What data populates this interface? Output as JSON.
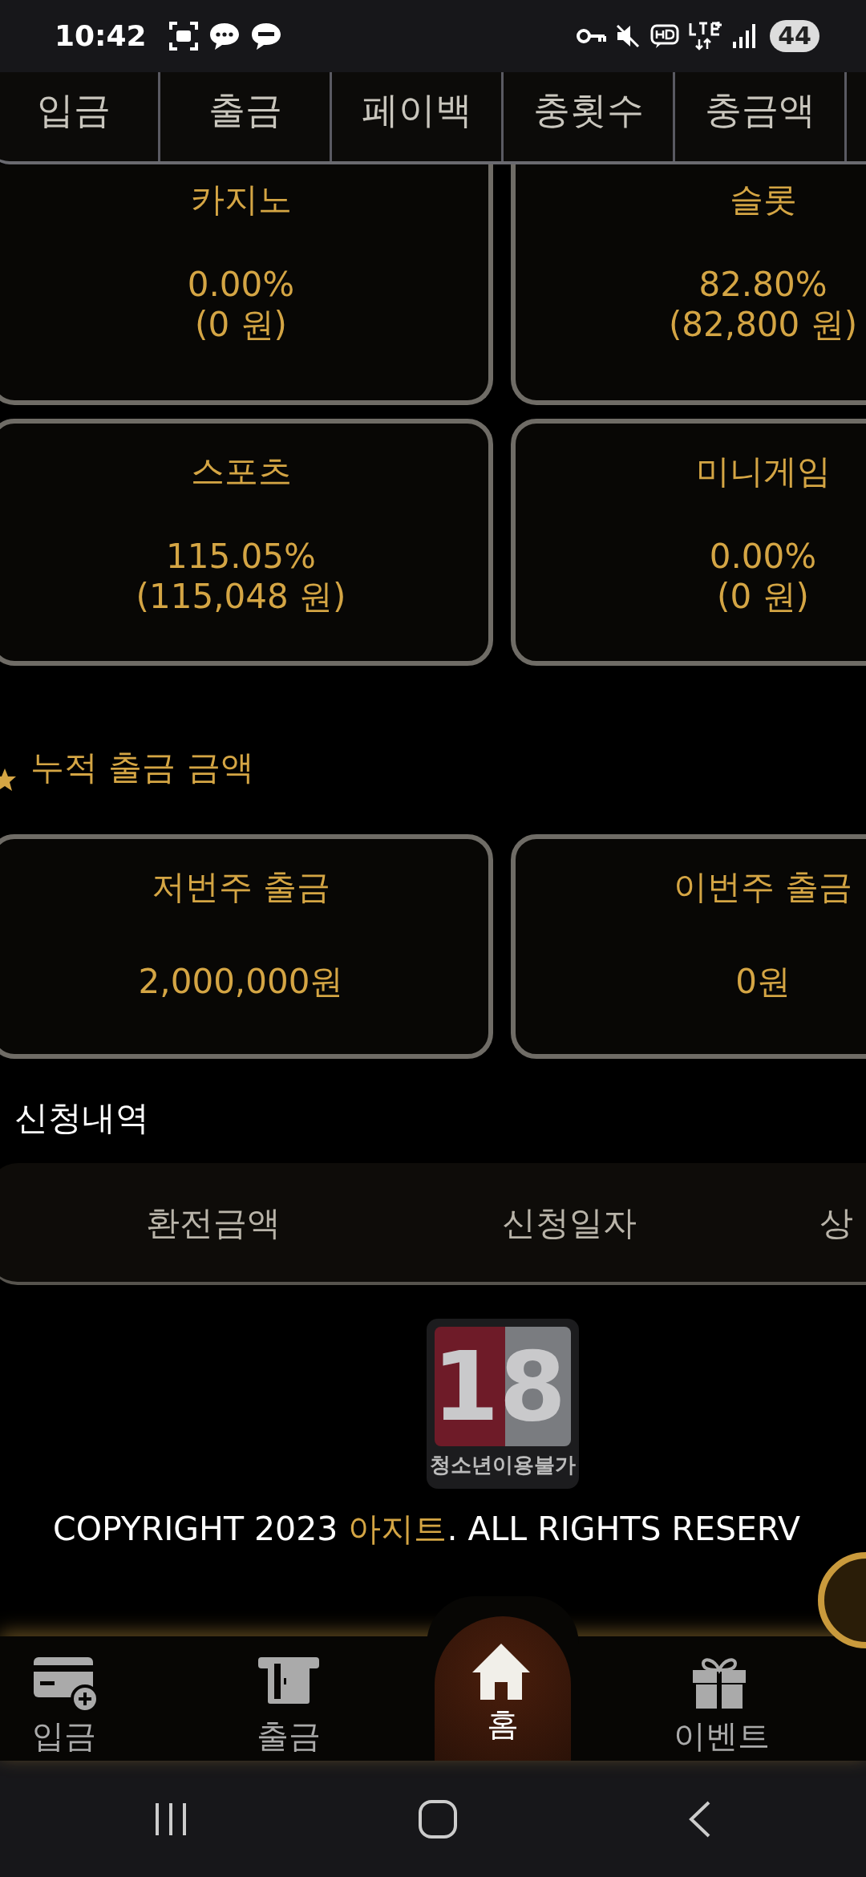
{
  "status_bar": {
    "time": "10:42",
    "battery": "44"
  },
  "tabs": [
    {
      "label": "입금"
    },
    {
      "label": "출금"
    },
    {
      "label": "페이백"
    },
    {
      "label": "충횟수"
    },
    {
      "label": "충금액"
    }
  ],
  "rate_cards": [
    {
      "title": "카지노",
      "percent": "0.00%",
      "amount": "(0 원)"
    },
    {
      "title": "슬롯",
      "percent": "82.80%",
      "amount": "(82,800 원)"
    },
    {
      "title": "스포츠",
      "percent": "115.05%",
      "amount": "(115,048 원)"
    },
    {
      "title": "미니게임",
      "percent": "0.00%",
      "amount": "(0 원)"
    }
  ],
  "withdraw_section": {
    "title": "누적 출금 금액",
    "cards": [
      {
        "title": "저번주 출금",
        "value": "2,000,000원"
      },
      {
        "title": "이번주 출금",
        "value": "0원"
      }
    ]
  },
  "history": {
    "title": "신청내역",
    "columns": [
      "환전금액",
      "신청일자",
      "상"
    ]
  },
  "age_badge": {
    "number": "18",
    "label": "청소년이용불가"
  },
  "copyright": "COPYRIGHT 2023 **아지트**. ALL RIGHTS RESERV",
  "bottom_nav": [
    {
      "kind": "deposit",
      "label": "입금",
      "selected": false
    },
    {
      "kind": "withdraw",
      "label": "출금",
      "selected": false
    },
    {
      "kind": "home",
      "label": "홈",
      "selected": true
    },
    {
      "kind": "event",
      "label": "이벤트",
      "selected": false
    }
  ]
}
